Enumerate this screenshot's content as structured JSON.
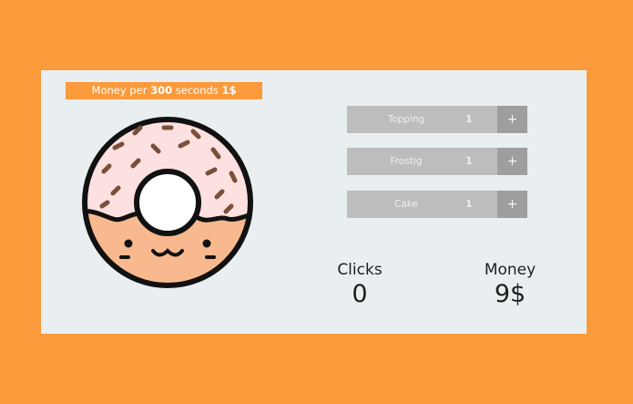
{
  "banner": {
    "prefix": "Money per",
    "seconds": "300",
    "middle": "seconds",
    "amount": "1$"
  },
  "donut_icon": "donut-clicker-icon",
  "upgrades": [
    {
      "name": "Topping",
      "count": "1",
      "plus": "+"
    },
    {
      "name": "Frostig",
      "count": "1",
      "plus": "+"
    },
    {
      "name": "Cake",
      "count": "1",
      "plus": "+"
    }
  ],
  "stats": {
    "clicks_label": "Clicks",
    "clicks_value": "0",
    "money_label": "Money",
    "money_value": "9$"
  },
  "colors": {
    "background": "#fb9a3b",
    "card": "#e9eff0",
    "frosting": "#fde0e0",
    "dough": "#f8b98f",
    "sprinkles": "#7a4f3a",
    "upgrade_row": "#bdbdbd",
    "plus_button": "#9e9e9e"
  }
}
